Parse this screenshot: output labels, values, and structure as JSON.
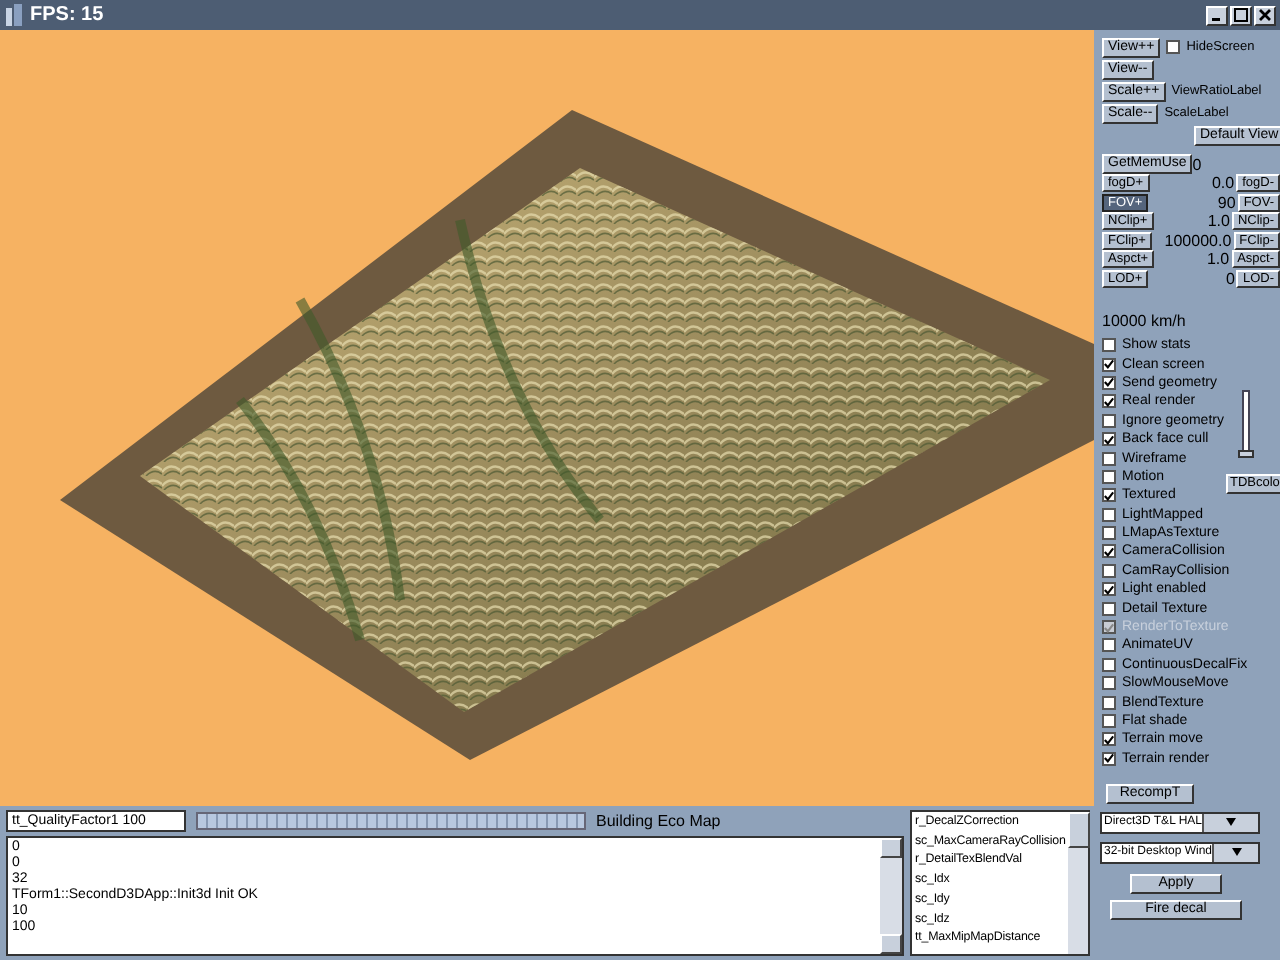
{
  "window": {
    "title": "FPS: 15"
  },
  "view_buttons": [
    {
      "label": "View++",
      "kind": "checkbox",
      "side_label": "HideScreen",
      "checked": false
    },
    {
      "label": "View--",
      "kind": "plain"
    },
    {
      "label": "Scale++",
      "kind": "text",
      "side_label": "ViewRatioLabel"
    },
    {
      "label": "Scale--",
      "kind": "text",
      "side_label": "ScaleLabel"
    }
  ],
  "default_view_button": "Default View",
  "memory": {
    "button": "GetMemUse",
    "value": "0"
  },
  "adjusters": [
    {
      "plus": "fogD+",
      "value": "0.0",
      "minus": "fogD-",
      "focused": false
    },
    {
      "plus": "FOV+",
      "value": "90",
      "minus": "FOV-",
      "focused": true
    },
    {
      "plus": "NClip+",
      "value": "1.0",
      "minus": "NClip-",
      "focused": false
    },
    {
      "plus": "FClip+",
      "value": "100000.0",
      "minus": "FClip-",
      "focused": false
    },
    {
      "plus": "Aspct+",
      "value": "1.0",
      "minus": "Aspct-",
      "focused": false
    },
    {
      "plus": "LOD+",
      "value": "0",
      "minus": "LOD-",
      "focused": false
    }
  ],
  "speed": "10000 km/h",
  "options": [
    {
      "label": "Show stats",
      "checked": false,
      "disabled": false
    },
    {
      "label": "Clean screen",
      "checked": true,
      "disabled": false
    },
    {
      "label": "Send geometry",
      "checked": true,
      "disabled": false
    },
    {
      "label": "Real render",
      "checked": true,
      "disabled": false
    },
    {
      "label": "Ignore geometry",
      "checked": false,
      "disabled": false
    },
    {
      "label": "Back face cull",
      "checked": true,
      "disabled": false
    },
    {
      "label": "Wireframe",
      "checked": false,
      "disabled": false
    },
    {
      "label": "Motion",
      "checked": false,
      "disabled": false
    },
    {
      "label": "Textured",
      "checked": true,
      "disabled": false
    },
    {
      "label": "LightMapped",
      "checked": false,
      "disabled": false
    },
    {
      "label": "LMapAsTexture",
      "checked": false,
      "disabled": false
    },
    {
      "label": "CameraCollision",
      "checked": true,
      "disabled": false
    },
    {
      "label": "CamRayCollision",
      "checked": false,
      "disabled": false
    },
    {
      "label": "Light enabled",
      "checked": true,
      "disabled": false
    },
    {
      "label": "Detail Texture",
      "checked": false,
      "disabled": false
    },
    {
      "label": "RenderToTexture",
      "checked": true,
      "disabled": true
    },
    {
      "label": "AnimateUV",
      "checked": false,
      "disabled": false
    },
    {
      "label": "ContinuousDecalFix",
      "checked": false,
      "disabled": false
    },
    {
      "label": "SlowMouseMove",
      "checked": false,
      "disabled": false
    },
    {
      "label": "BlendTexture",
      "checked": false,
      "disabled": false
    },
    {
      "label": "Flat shade",
      "checked": false,
      "disabled": false
    },
    {
      "label": "Terrain move",
      "checked": true,
      "disabled": false
    },
    {
      "label": "Terrain render",
      "checked": true,
      "disabled": false
    }
  ],
  "slider": {
    "level": 0
  },
  "tdb_button": "TDBcolo",
  "recompute_button": "RecompT",
  "command_field": {
    "value": "tt_QualityFactor1 100"
  },
  "progress": {
    "level": 1
  },
  "status_label": "Building Eco Map",
  "log_lines": [
    "0",
    "0",
    "32",
    "TForm1::SecondD3DApp::Init3d Init OK",
    "10",
    "100"
  ],
  "variables": [
    {
      "label": "r_DecalZCorrection",
      "selected": false
    },
    {
      "label": "sc_MaxCameraRayCollision",
      "selected": false
    },
    {
      "label": "r_DetailTexBlendVal",
      "selected": false
    },
    {
      "label": "sc_Idx",
      "selected": false
    },
    {
      "label": "sc_Idy",
      "selected": false
    },
    {
      "label": "sc_Idz",
      "selected": false
    },
    {
      "label": "tt_MaxMipMapDistance",
      "selected": false
    }
  ],
  "device_dropdown": "Direct3D T&L HAL",
  "mode_dropdown": "32-bit Desktop Wind",
  "apply_button": "Apply",
  "fire_button": "Fire decal"
}
